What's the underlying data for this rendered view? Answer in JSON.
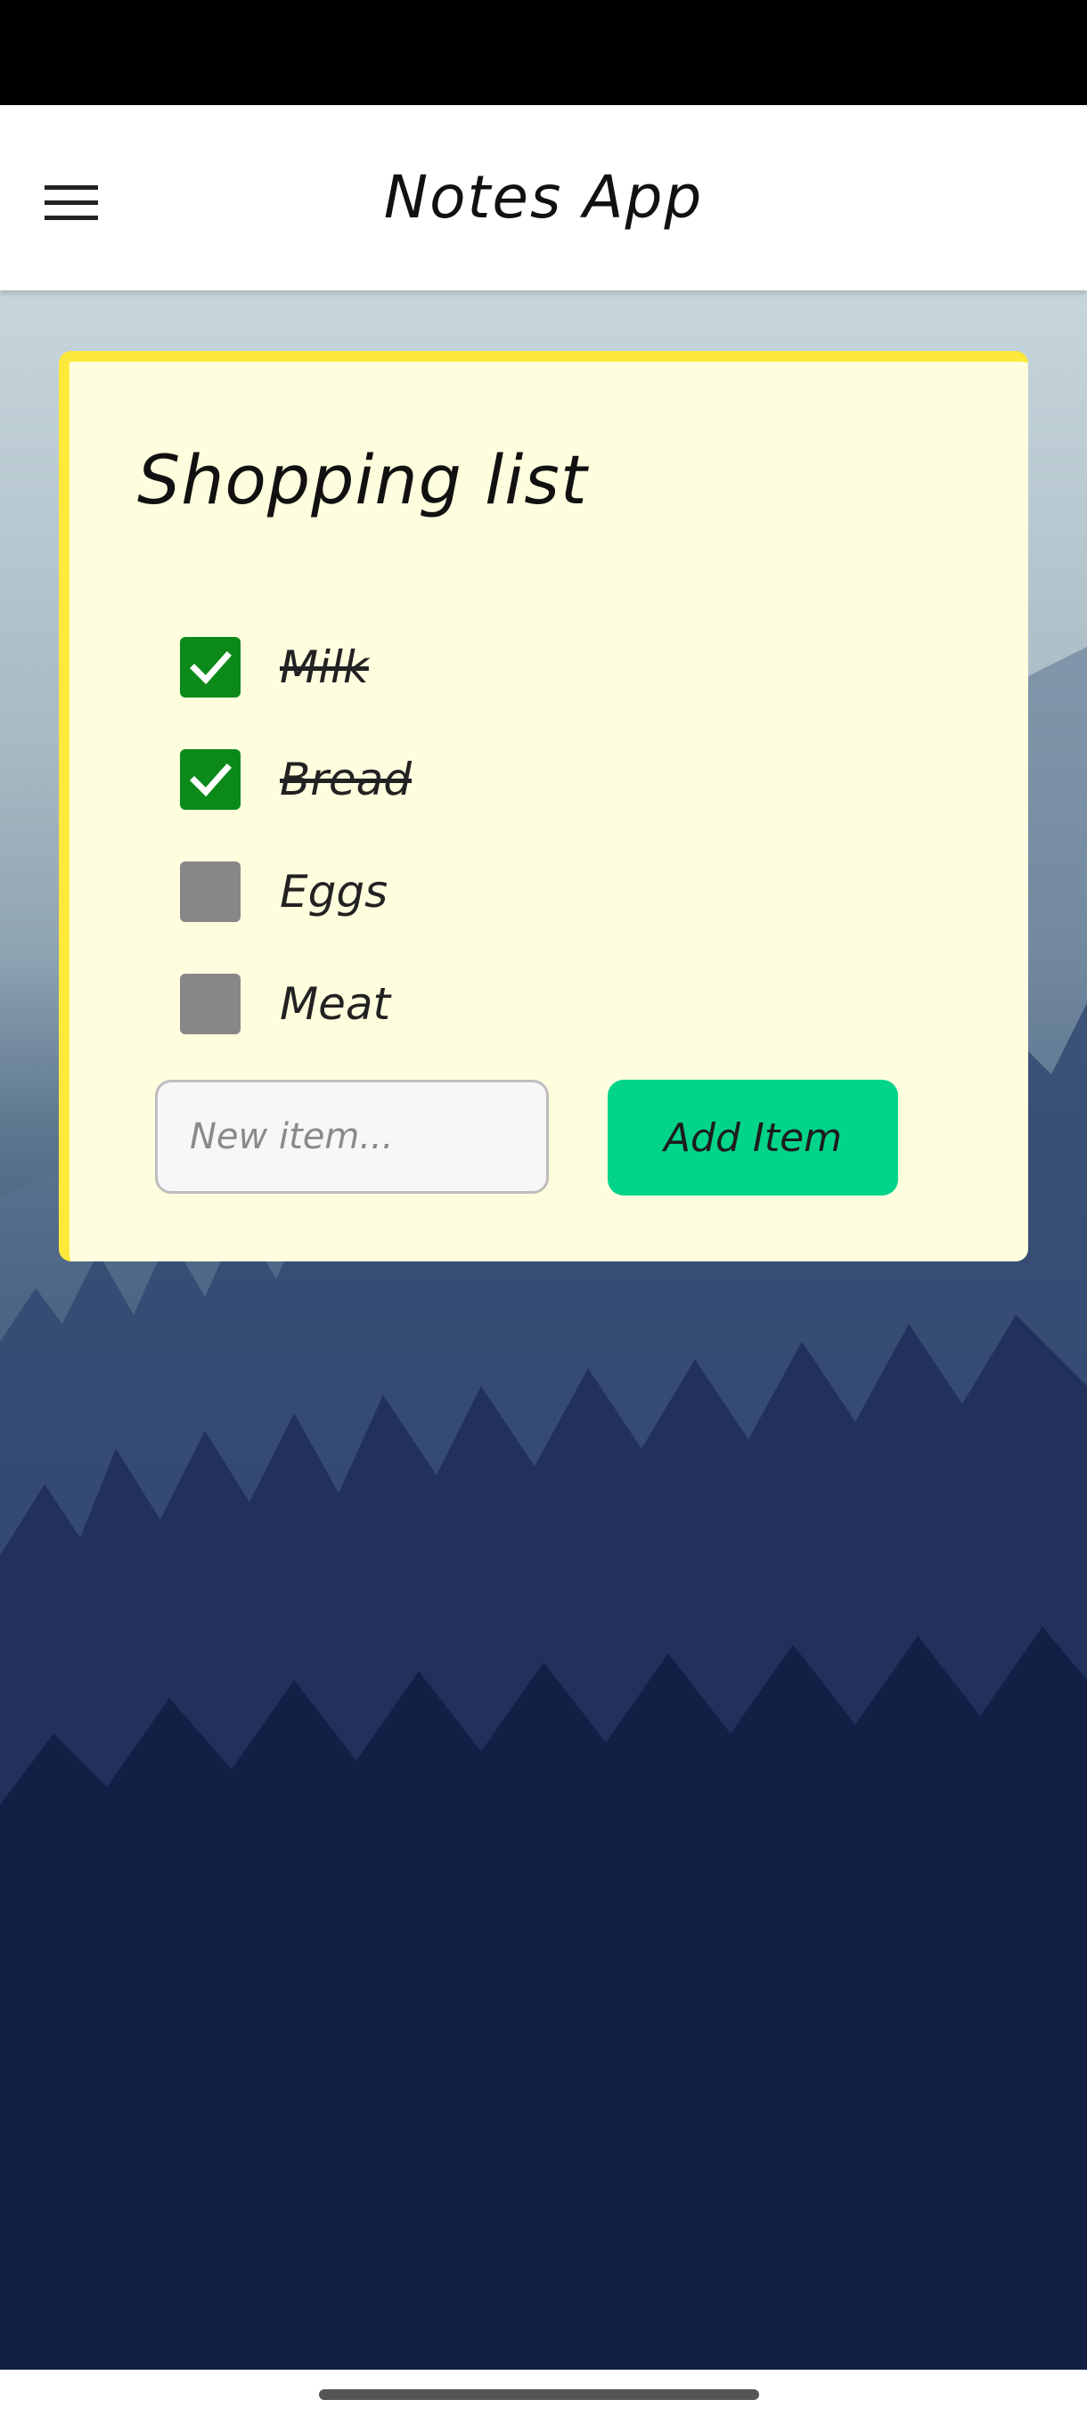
{
  "app_bar": {
    "title": "Notes App",
    "menu_icon": "hamburger-menu-icon"
  },
  "note": {
    "title": "Shopping list",
    "accent_color": "#fde93b",
    "background_color": "#fefedf",
    "items": [
      {
        "label": "Milk",
        "checked": true
      },
      {
        "label": "Bread",
        "checked": true
      },
      {
        "label": "Eggs",
        "checked": false
      },
      {
        "label": "Meat",
        "checked": false
      }
    ],
    "new_item": {
      "value": "",
      "placeholder": "New item..."
    },
    "add_button_label": "Add Item",
    "add_button_color": "#02d48a",
    "checked_color": "#0b8a1a",
    "unchecked_color": "#878787"
  },
  "background": {
    "description_icon": "forest-landscape-image"
  }
}
